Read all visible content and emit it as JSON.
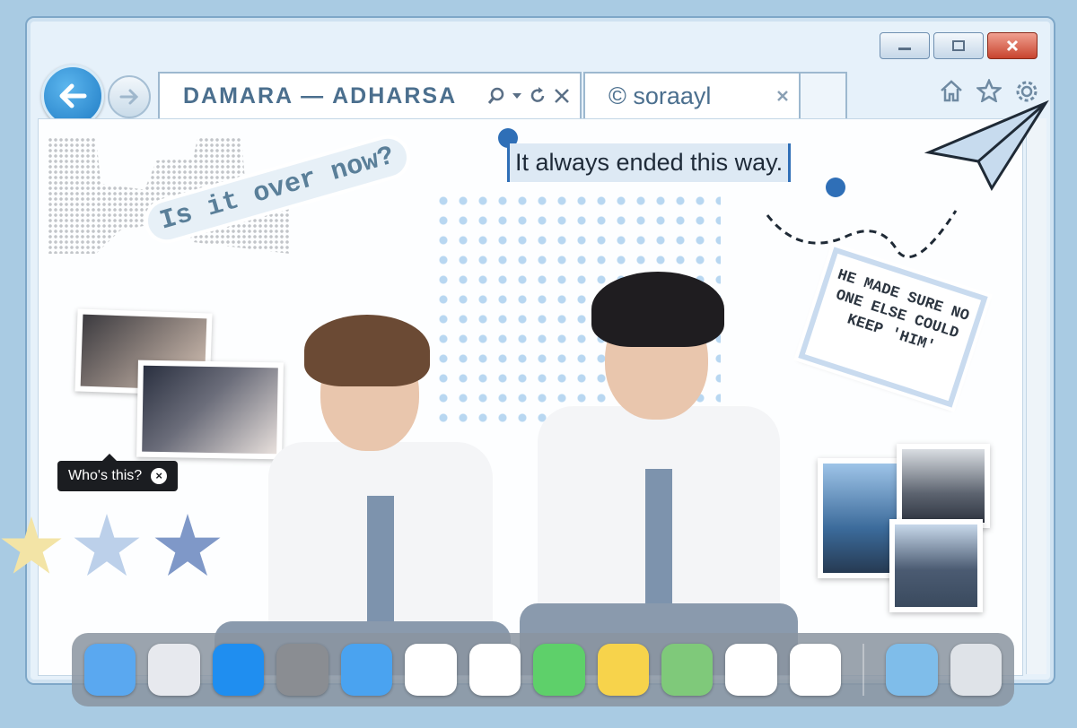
{
  "browser": {
    "address": "DAMARA  —  ADHARSA",
    "tab_title": "© soraayl",
    "controls": {
      "minimize": "minimize-icon",
      "maximize": "maximize-icon",
      "close": "close-icon"
    }
  },
  "stickers": {
    "title": "Is it over now?",
    "quote": "It always ended this way.",
    "note": "He made sure no one else could keep 'Him'"
  },
  "tooltip": {
    "text": "Who's this?"
  },
  "dock": {
    "apps": [
      {
        "name": "finder",
        "color": "#5aa8f0"
      },
      {
        "name": "launchpad",
        "color": "#e7e9ee"
      },
      {
        "name": "app-store",
        "color": "#1f8ef0"
      },
      {
        "name": "system-settings",
        "color": "#8a8d92"
      },
      {
        "name": "mail",
        "color": "#4aa3f0"
      },
      {
        "name": "safari",
        "color": "#ffffff"
      },
      {
        "name": "slack",
        "color": "#ffffff"
      },
      {
        "name": "messages",
        "color": "#5ed06a"
      },
      {
        "name": "notes",
        "color": "#f7d34b"
      },
      {
        "name": "maps",
        "color": "#7fc97a"
      },
      {
        "name": "chrome",
        "color": "#ffffff"
      },
      {
        "name": "photos",
        "color": "#ffffff"
      }
    ],
    "folder": {
      "name": "downloads-folder",
      "color": "#7fbdea"
    },
    "trash": {
      "name": "trash",
      "color": "#dfe3e8"
    }
  },
  "colors": {
    "accent": "#2f6fb7",
    "frame": "#a9cbe3",
    "text": "#4b6f8e"
  }
}
